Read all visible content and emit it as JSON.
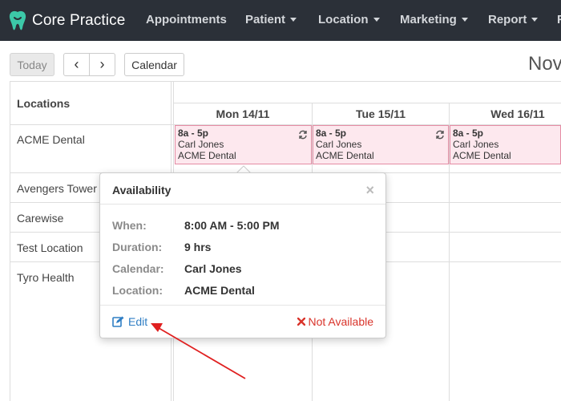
{
  "brand": {
    "name": "Core Practice"
  },
  "nav": {
    "appointments": "Appointments",
    "patient": "Patient",
    "location": "Location",
    "marketing": "Marketing",
    "report": "Report",
    "more": "R"
  },
  "toolbar": {
    "today": "Today",
    "prev": "‹",
    "next": "›",
    "calendar": "Calendar",
    "month_title": "Nov"
  },
  "grid": {
    "locations_header": "Locations",
    "locations": [
      "ACME Dental",
      "Avengers Tower",
      "Carewise",
      "Test Location",
      "Tyro Health"
    ],
    "days": [
      "Mon 14/11",
      "Tue 15/11",
      "Wed 16/11"
    ]
  },
  "events": [
    {
      "time": "8a - 5p",
      "person": "Carl Jones",
      "location": "ACME Dental"
    },
    {
      "time": "8a - 5p",
      "person": "Carl Jones",
      "location": "ACME Dental"
    },
    {
      "time": "8a - 5p",
      "person": "Carl Jones",
      "location": "ACME Dental"
    }
  ],
  "popover": {
    "title": "Availability",
    "close": "×",
    "rows": [
      {
        "label": "When:",
        "value": "8:00 AM - 5:00 PM"
      },
      {
        "label": "Duration:",
        "value": "9 hrs"
      },
      {
        "label": "Calendar:",
        "value": "Carl Jones"
      },
      {
        "label": "Location:",
        "value": "ACME Dental"
      }
    ],
    "edit": "Edit",
    "not_available": "Not Available"
  },
  "colors": {
    "navbar": "#2b3038",
    "event_bg": "#fde8ee",
    "event_border": "#e58ca4",
    "link": "#2f7ec4",
    "danger": "#d9342b",
    "annotation": "#e02020"
  }
}
